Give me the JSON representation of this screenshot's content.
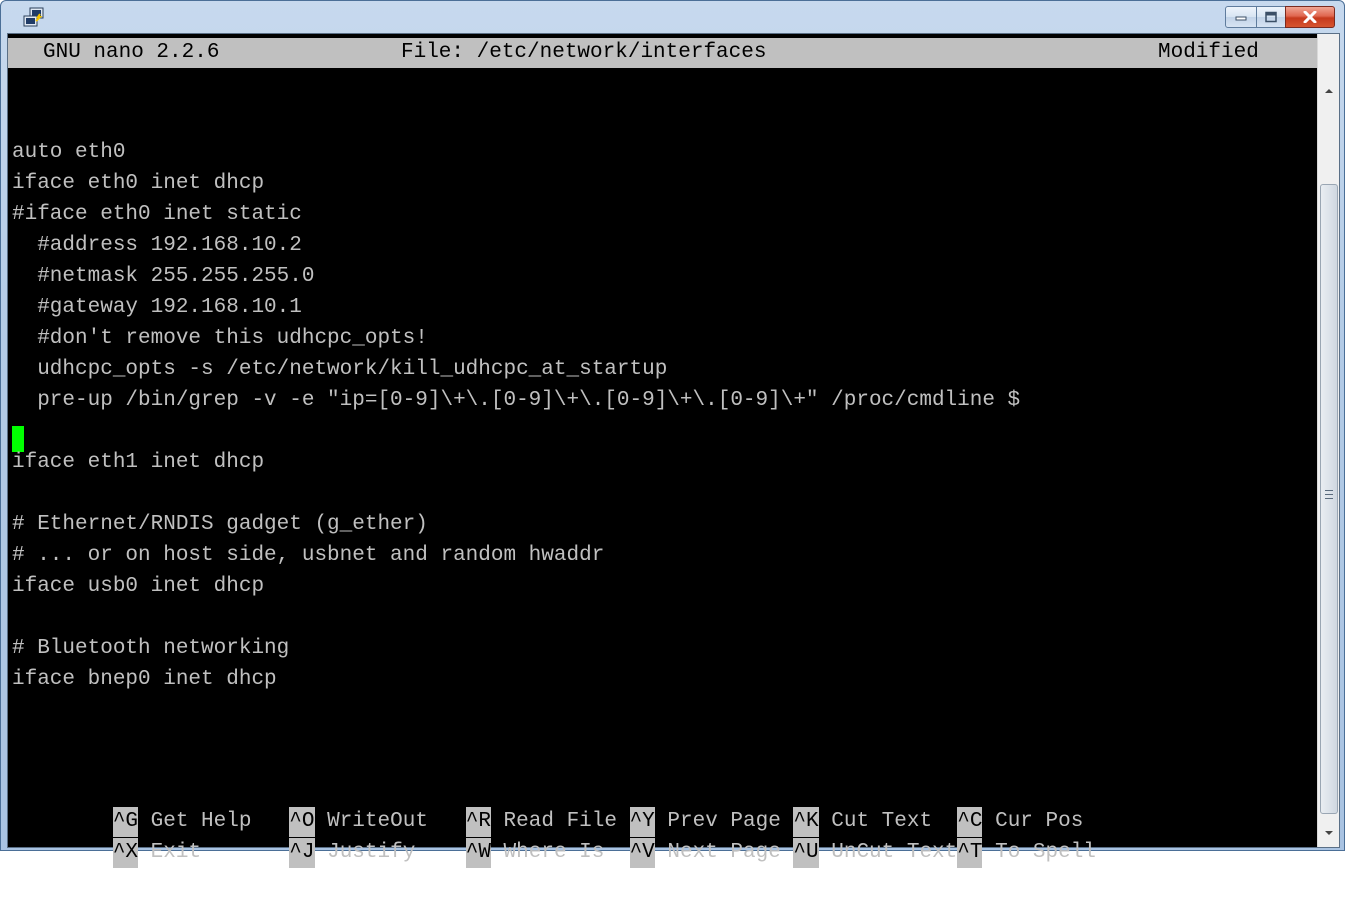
{
  "window": {
    "icon": "putty-icon",
    "controls": [
      "minimize-icon",
      "maximize-icon",
      "close-icon"
    ]
  },
  "nano": {
    "version": "GNU nano 2.2.6",
    "file": "File: /etc/network/interfaces",
    "status": "Modified"
  },
  "editor": {
    "lines": [
      "",
      "auto eth0",
      "iface eth0 inet dhcp",
      "#iface eth0 inet static",
      "  #address 192.168.10.2",
      "  #netmask 255.255.255.0",
      "  #gateway 192.168.10.1",
      "  #don't remove this udhcpc_opts!",
      "  udhcpc_opts -s /etc/network/kill_udhcpc_at_startup",
      "  pre-up /bin/grep -v -e \"ip=[0-9]\\+\\.[0-9]\\+\\.[0-9]\\+\\.[0-9]\\+\" /proc/cmdline $",
      "",
      "iface eth1 inet dhcp",
      "",
      "# Ethernet/RNDIS gadget (g_ether)",
      "# ... or on host side, usbnet and random hwaddr",
      "iface usb0 inet dhcp",
      "",
      "# Bluetooth networking",
      "iface bnep0 inet dhcp"
    ]
  },
  "shortcuts": {
    "row1": [
      {
        "key": "^G",
        "label": " Get Help  "
      },
      {
        "key": "^O",
        "label": " WriteOut  "
      },
      {
        "key": "^R",
        "label": " Read File "
      },
      {
        "key": "^Y",
        "label": " Prev Page "
      },
      {
        "key": "^K",
        "label": " Cut Text  "
      },
      {
        "key": "^C",
        "label": " Cur Pos"
      }
    ],
    "row2": [
      {
        "key": "^X",
        "label": " Exit      "
      },
      {
        "key": "^J",
        "label": " Justify   "
      },
      {
        "key": "^W",
        "label": " Where Is  "
      },
      {
        "key": "^V",
        "label": " Next Page "
      },
      {
        "key": "^U",
        "label": " UnCut Text"
      },
      {
        "key": "^T",
        "label": " To Spell"
      }
    ]
  },
  "colors": {
    "terminal_bg": "#000000",
    "terminal_fg": "#c0c0c0",
    "cursor": "#00ff00",
    "header_bg": "#c0c0c0"
  }
}
